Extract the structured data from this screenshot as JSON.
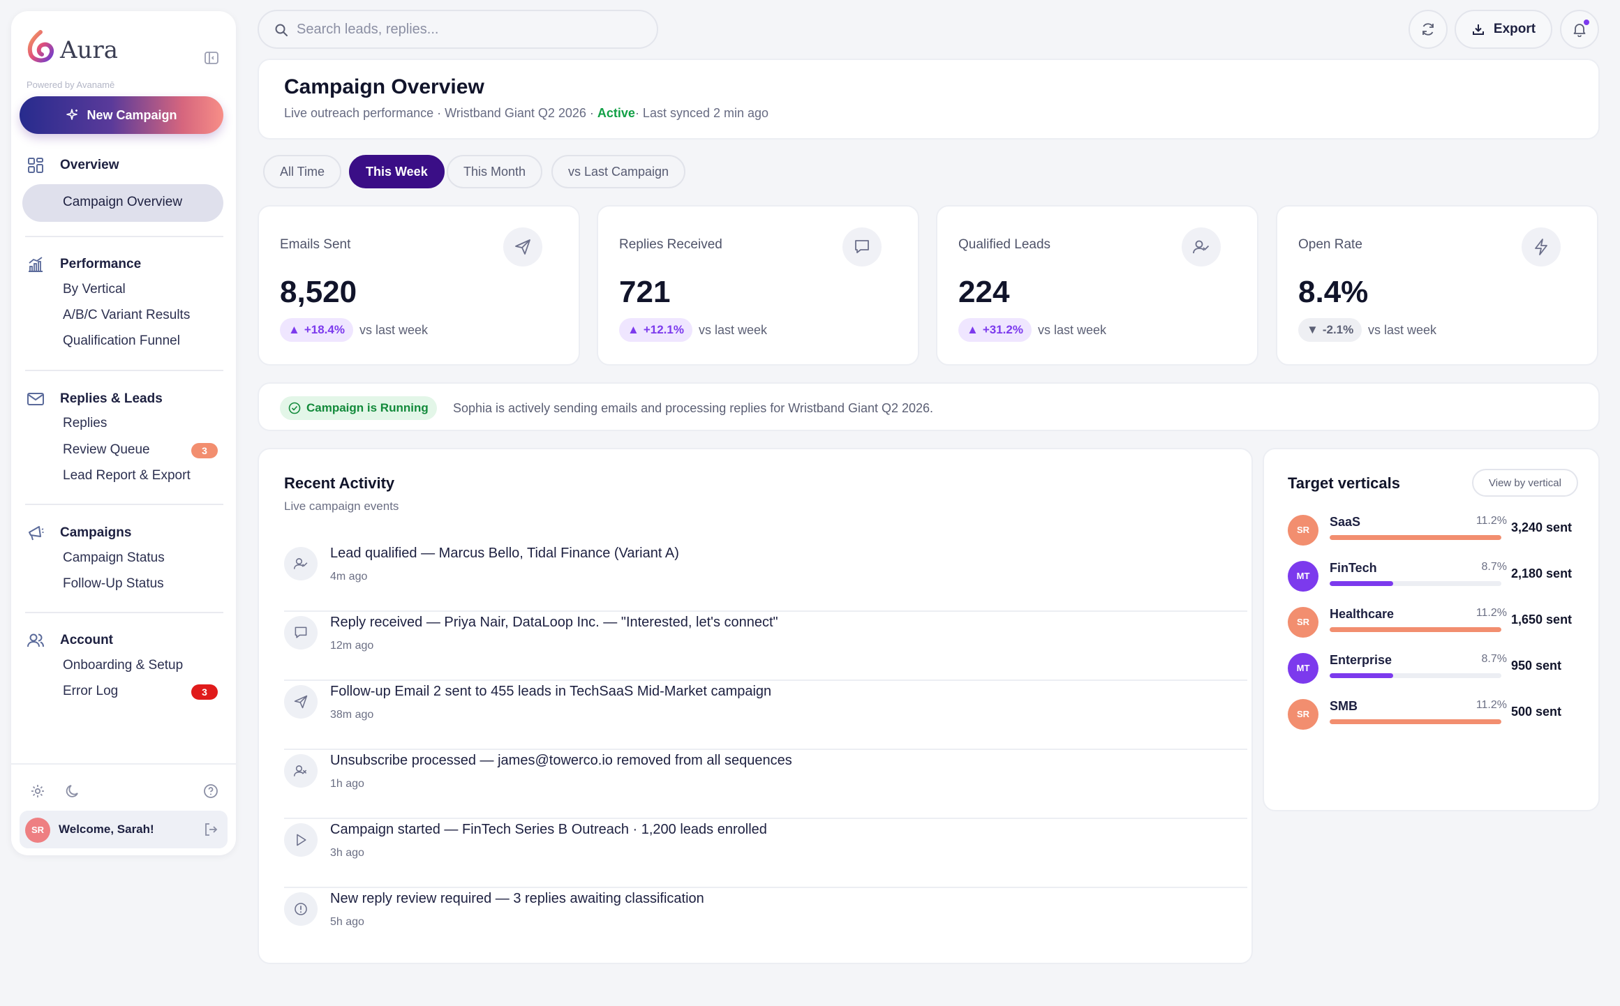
{
  "brand": {
    "name": "Aura",
    "powered_by": "Powered by Avanamē"
  },
  "sidebar": {
    "new_campaign_label": "New Campaign",
    "sections": [
      {
        "title": "Overview",
        "icon": "grid-icon",
        "items": [
          "Campaign Overview"
        ]
      },
      {
        "title": "Performance",
        "icon": "chart-icon",
        "items": [
          "By Vertical",
          "A/B/C Variant Results",
          "Qualification Funnel"
        ]
      },
      {
        "title": "Replies & Leads",
        "icon": "mail-icon",
        "items": [
          "Replies",
          "Review Queue",
          "Lead Report & Export"
        ]
      },
      {
        "title": "Campaigns",
        "icon": "megaphone-icon",
        "items": [
          "Campaign Status",
          "Follow-Up Status"
        ]
      },
      {
        "title": "Account",
        "icon": "users-icon",
        "items": [
          "Onboarding & Setup",
          "Error Log"
        ]
      }
    ],
    "active_item": "Campaign Overview",
    "badges": {
      "review_queue": "3",
      "error_log": "3"
    },
    "badge_colors": {
      "review_queue": "#f28e6f",
      "error_log": "#e01b1b"
    },
    "user": {
      "initials": "SR",
      "welcome": "Welcome, Sarah!"
    }
  },
  "topbar": {
    "search_placeholder": "Search leads, replies...",
    "export_label": "Export"
  },
  "header": {
    "title": "Campaign Overview",
    "subtitle_prefix": "Live outreach performance · Wristband Giant Q2 2026 · ",
    "status": "Active",
    "subtitle_suffix": "· Last synced 2 min ago"
  },
  "tabs": [
    "All Time",
    "This Week",
    "This Month",
    "vs Last Campaign"
  ],
  "selected_tab": "This Week",
  "stats": [
    {
      "label": "Emails Sent",
      "value": "8,520",
      "delta": "+18.4%",
      "direction": "up",
      "compare": "vs last week",
      "icon": "send-icon"
    },
    {
      "label": "Replies Received",
      "value": "721",
      "delta": "+12.1%",
      "direction": "up",
      "compare": "vs last week",
      "icon": "chat-icon"
    },
    {
      "label": "Qualified Leads",
      "value": "224",
      "delta": "+31.2%",
      "direction": "up",
      "compare": "vs last week",
      "icon": "user-check-icon"
    },
    {
      "label": "Open Rate",
      "value": "8.4%",
      "delta": "-2.1%",
      "direction": "down",
      "compare": "vs last week",
      "icon": "bolt-icon"
    }
  ],
  "status_bar": {
    "pill": "Campaign is Running",
    "message": "Sophia is actively sending emails and processing replies for Wristband Giant Q2 2026."
  },
  "activity": {
    "title": "Recent Activity",
    "subtitle": "Live campaign events",
    "items": [
      {
        "text": "Lead qualified — Marcus Bello, Tidal Finance (Variant A)",
        "time": "4m ago",
        "icon": "user-check-icon"
      },
      {
        "text": "Reply received — Priya Nair, DataLoop Inc. — \"Interested, let's connect\"",
        "time": "12m ago",
        "icon": "chat-icon"
      },
      {
        "text": "Follow-up Email 2 sent to 455 leads in TechSaaS Mid-Market campaign",
        "time": "38m ago",
        "icon": "send-icon"
      },
      {
        "text": "Unsubscribe processed — james@towerco.io removed from all sequences",
        "time": "1h ago",
        "icon": "user-x-icon"
      },
      {
        "text": "Campaign started — FinTech Series B Outreach · 1,200 leads enrolled",
        "time": "3h ago",
        "icon": "play-icon"
      },
      {
        "text": "New reply review required — 3 replies awaiting classification",
        "time": "5h ago",
        "icon": "alert-icon"
      }
    ]
  },
  "verticals": {
    "title": "Target verticals",
    "view_button": "View by vertical",
    "items": [
      {
        "initials": "SR",
        "name": "SaaS",
        "pct": "11.2%",
        "fill": 1.0,
        "sent": "3,240 sent",
        "color": "#f28e6f"
      },
      {
        "initials": "MT",
        "name": "FinTech",
        "pct": "8.7%",
        "fill": 0.37,
        "sent": "2,180 sent",
        "color": "#7c3aed"
      },
      {
        "initials": "SR",
        "name": "Healthcare",
        "pct": "11.2%",
        "fill": 1.0,
        "sent": "1,650 sent",
        "color": "#f28e6f"
      },
      {
        "initials": "MT",
        "name": "Enterprise",
        "pct": "8.7%",
        "fill": 0.37,
        "sent": "950 sent",
        "color": "#7c3aed"
      },
      {
        "initials": "SR",
        "name": "SMB",
        "pct": "11.2%",
        "fill": 1.0,
        "sent": "500 sent",
        "color": "#f28e6f"
      }
    ]
  }
}
